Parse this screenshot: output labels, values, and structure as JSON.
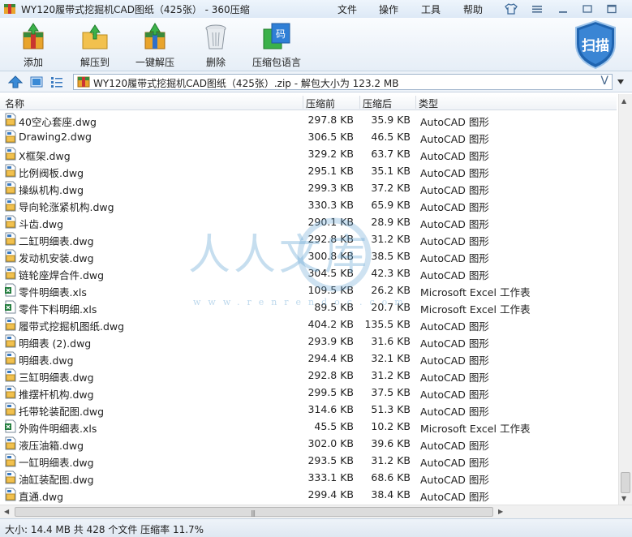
{
  "window": {
    "title": "WY120履带式挖掘机CAD图纸（425张） - 360压缩",
    "menus": [
      "文件",
      "操作",
      "工具",
      "帮助"
    ]
  },
  "toolbar": {
    "add": "添加",
    "extract_to": "解压到",
    "one_click_extract": "一键解压",
    "delete": "删除",
    "archive_language": "压缩包语言",
    "scan": "扫描"
  },
  "address": {
    "path": "WY120履带式挖掘机CAD图纸（425张）.zip - 解包大小为 123.2 MB",
    "dropdown_glyph": "V"
  },
  "columns": {
    "name": "名称",
    "compressed": "压缩前",
    "original": "压缩后",
    "type": "类型"
  },
  "files": [
    {
      "name": "40空心套座.dwg",
      "before": "297.8 KB",
      "after": "35.9 KB",
      "type": "AutoCAD 图形",
      "icon": "dwg-file-icon"
    },
    {
      "name": "Drawing2.dwg",
      "before": "306.5 KB",
      "after": "46.5 KB",
      "type": "AutoCAD 图形",
      "icon": "dwg-file-icon"
    },
    {
      "name": "X框架.dwg",
      "before": "329.2 KB",
      "after": "63.7 KB",
      "type": "AutoCAD 图形",
      "icon": "dwg-file-icon"
    },
    {
      "name": "比例阀板.dwg",
      "before": "295.1 KB",
      "after": "35.1 KB",
      "type": "AutoCAD 图形",
      "icon": "dwg-file-icon"
    },
    {
      "name": "操纵机构.dwg",
      "before": "299.3 KB",
      "after": "37.2 KB",
      "type": "AutoCAD 图形",
      "icon": "dwg-file-icon"
    },
    {
      "name": "导向轮涨紧机构.dwg",
      "before": "330.3 KB",
      "after": "65.9 KB",
      "type": "AutoCAD 图形",
      "icon": "dwg-file-icon"
    },
    {
      "name": "斗齿.dwg",
      "before": "290.1 KB",
      "after": "28.9 KB",
      "type": "AutoCAD 图形",
      "icon": "dwg-file-icon"
    },
    {
      "name": "二缸明细表.dwg",
      "before": "292.8 KB",
      "after": "31.2 KB",
      "type": "AutoCAD 图形",
      "icon": "dwg-file-icon"
    },
    {
      "name": "发动机安装.dwg",
      "before": "300.8 KB",
      "after": "38.5 KB",
      "type": "AutoCAD 图形",
      "icon": "dwg-file-icon"
    },
    {
      "name": "链轮座焊合件.dwg",
      "before": "304.5 KB",
      "after": "42.3 KB",
      "type": "AutoCAD 图形",
      "icon": "dwg-file-icon"
    },
    {
      "name": "零件明细表.xls",
      "before": "109.5 KB",
      "after": "26.2 KB",
      "type": "Microsoft Excel 工作表",
      "icon": "xls-file-icon"
    },
    {
      "name": "零件下料明细.xls",
      "before": "89.5 KB",
      "after": "20.7 KB",
      "type": "Microsoft Excel 工作表",
      "icon": "xls-file-icon"
    },
    {
      "name": "履带式挖掘机图纸.dwg",
      "before": "404.2 KB",
      "after": "135.5 KB",
      "type": "AutoCAD 图形",
      "icon": "dwg-file-icon"
    },
    {
      "name": "明细表 (2).dwg",
      "before": "293.9 KB",
      "after": "31.6 KB",
      "type": "AutoCAD 图形",
      "icon": "dwg-file-icon"
    },
    {
      "name": "明细表.dwg",
      "before": "294.4 KB",
      "after": "32.1 KB",
      "type": "AutoCAD 图形",
      "icon": "dwg-file-icon"
    },
    {
      "name": "三缸明细表.dwg",
      "before": "292.8 KB",
      "after": "31.2 KB",
      "type": "AutoCAD 图形",
      "icon": "dwg-file-icon"
    },
    {
      "name": "推摆杆机构.dwg",
      "before": "299.5 KB",
      "after": "37.5 KB",
      "type": "AutoCAD 图形",
      "icon": "dwg-file-icon"
    },
    {
      "name": "托带轮装配图.dwg",
      "before": "314.6 KB",
      "after": "51.3 KB",
      "type": "AutoCAD 图形",
      "icon": "dwg-file-icon"
    },
    {
      "name": "外购件明细表.xls",
      "before": "45.5 KB",
      "after": "10.2 KB",
      "type": "Microsoft Excel 工作表",
      "icon": "xls-file-icon"
    },
    {
      "name": "液压油箱.dwg",
      "before": "302.0 KB",
      "after": "39.6 KB",
      "type": "AutoCAD 图形",
      "icon": "dwg-file-icon"
    },
    {
      "name": "一缸明细表.dwg",
      "before": "293.5 KB",
      "after": "31.2 KB",
      "type": "AutoCAD 图形",
      "icon": "dwg-file-icon"
    },
    {
      "name": "油缸装配图.dwg",
      "before": "333.1 KB",
      "after": "68.6 KB",
      "type": "AutoCAD 图形",
      "icon": "dwg-file-icon"
    },
    {
      "name": "直通.dwg",
      "before": "299.4 KB",
      "after": "38.4 KB",
      "type": "AutoCAD 图形",
      "icon": "dwg-file-icon"
    }
  ],
  "watermark": {
    "text": "人人文库",
    "url": "www.renrendoc.com"
  },
  "status": {
    "text": "大小: 14.4 MB 共 428 个文件 压缩率 11.7%"
  },
  "colors": {
    "accent": "#2a6fb8",
    "scan_shield": "#1f64b0"
  }
}
